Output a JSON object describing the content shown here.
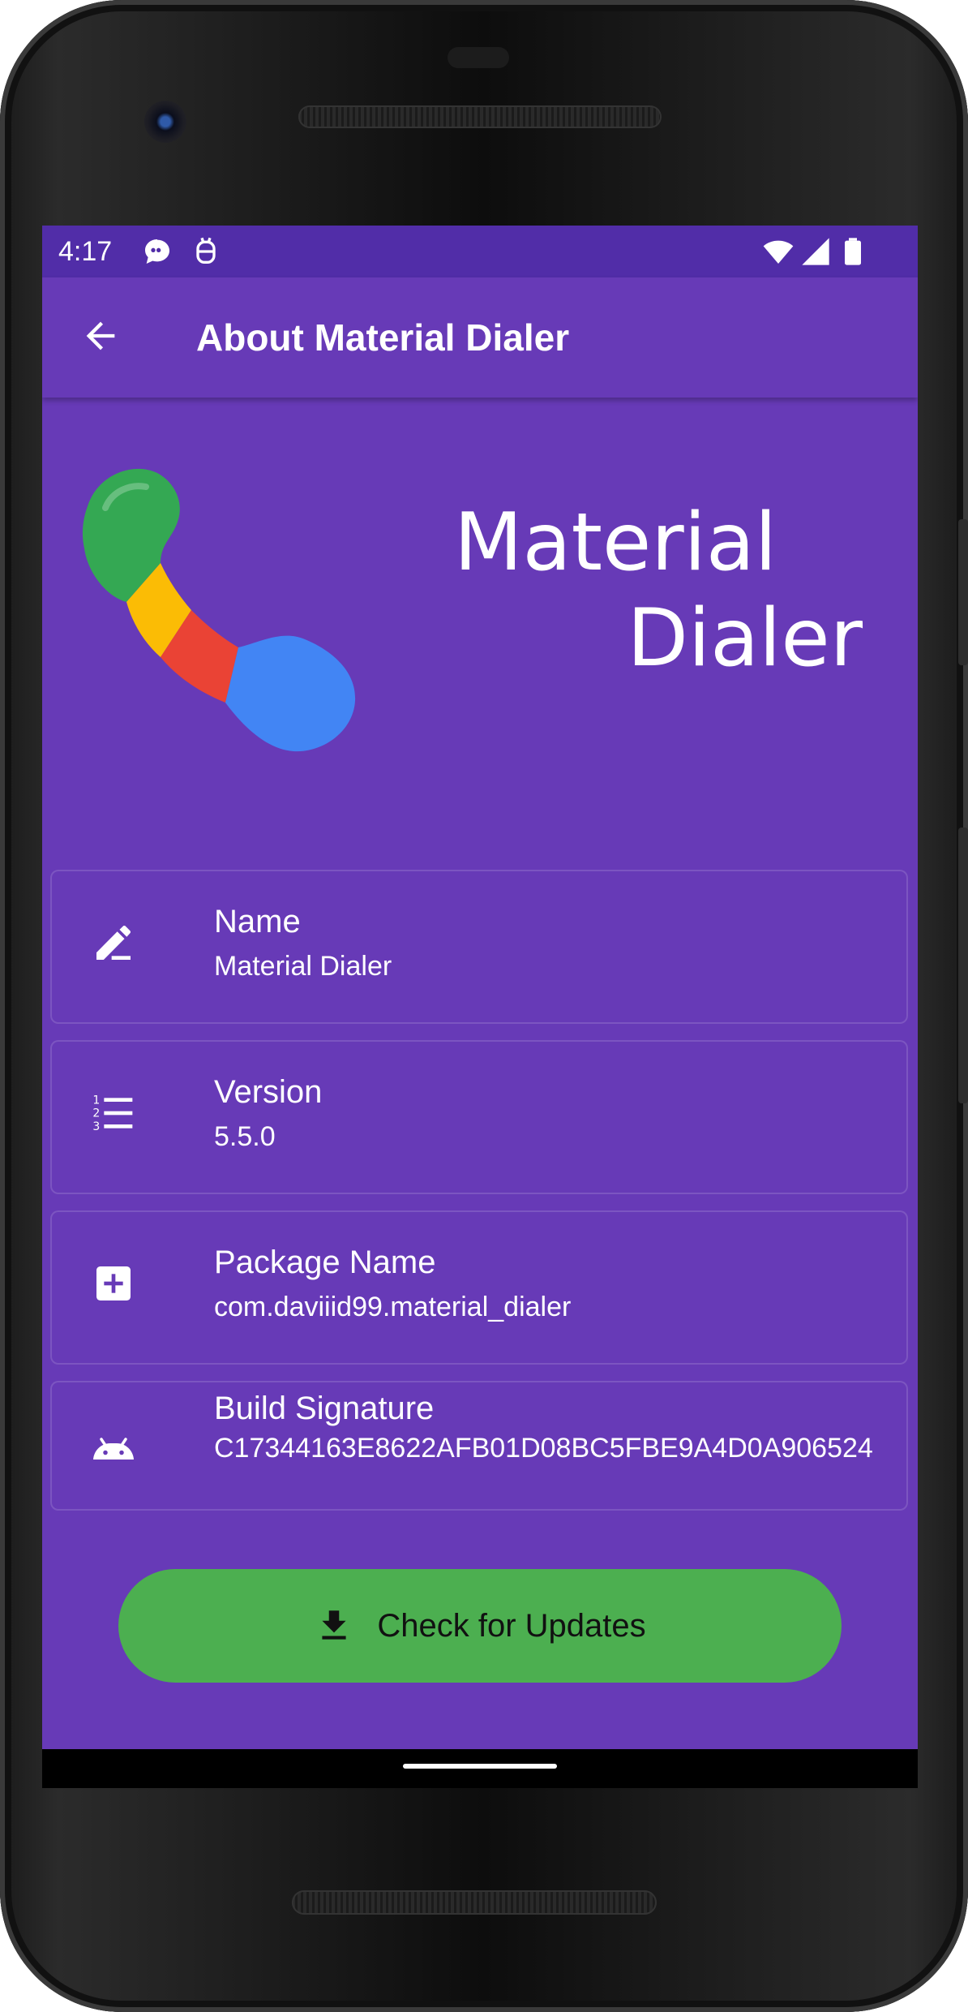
{
  "status_bar": {
    "time": "4:17",
    "icons_left": [
      "chat-bubble-icon",
      "debug-icon"
    ],
    "icons_right": [
      "wifi-icon",
      "signal-icon",
      "battery-icon"
    ]
  },
  "app_bar": {
    "title": "About Material Dialer",
    "back_icon": "arrow-back-icon"
  },
  "hero": {
    "title_line1": "Material",
    "title_line2": "Dialer"
  },
  "info": [
    {
      "label": "Name",
      "value": "Material Dialer",
      "icon": "pencil-icon"
    },
    {
      "label": "Version",
      "value": "5.5.0",
      "icon": "numbered-list-icon"
    },
    {
      "label": "Package Name",
      "value": "com.daviiid99.material_dialer",
      "icon": "add-box-icon"
    },
    {
      "label": "Build Signature",
      "value": "C17344163E8622AFB01D08BC5FBE9A4D0A906524",
      "icon": "android-icon"
    }
  ],
  "update_button": {
    "label": "Check for Updates",
    "icon": "download-icon"
  },
  "colors": {
    "primary": "#673ab7",
    "status_bar": "#512da8",
    "button": "#4caf50"
  }
}
